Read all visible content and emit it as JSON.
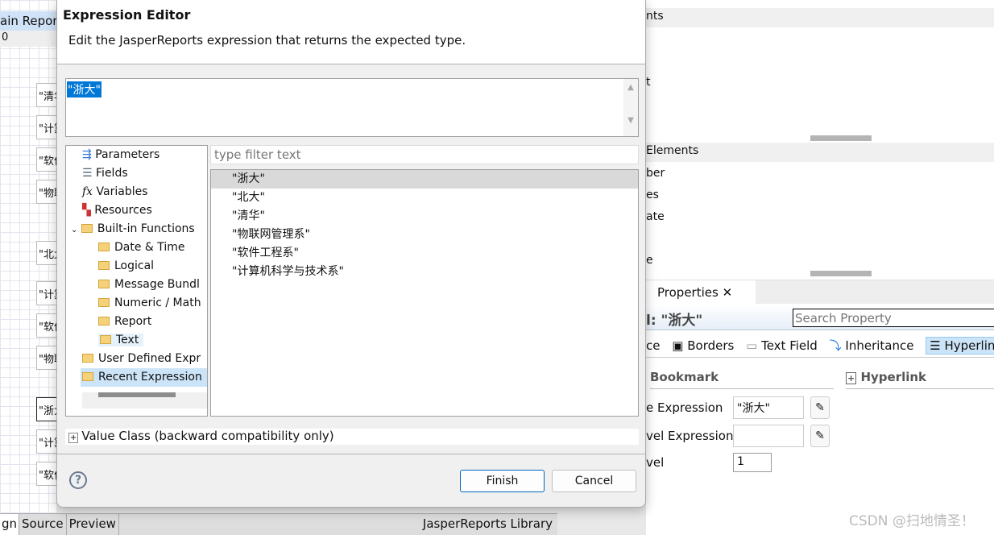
{
  "background_editor": {
    "tab_label": "ain Repor",
    "ruler": "0",
    "cells": [
      "\"清华",
      "\"计算",
      "\"软件",
      "\"物联",
      "\"北大",
      "\"计算",
      "\"软件",
      "\"物联",
      "\"浙大",
      "\"计算",
      "\"软件"
    ],
    "bottom_tabs": [
      "gn",
      "Source",
      "Preview"
    ],
    "library_label": "JasperReports Library"
  },
  "right_panel": {
    "section1_title": "nts",
    "section1_items": [
      "t"
    ],
    "section2_title": "Elements",
    "section2_items": [
      "ber",
      "es",
      "ate",
      "e"
    ],
    "properties_tab": "Properties",
    "element_title": "l: \"浙大\"",
    "search_placeholder": "Search Property",
    "tabs": [
      "ce",
      "Borders",
      "Text Field",
      "Inheritance",
      "Hyperlink"
    ],
    "bookmark_header": "Bookmark",
    "hyperlink_header": "Hyperlink",
    "rows": [
      {
        "label": "e Expression",
        "value": "\"浙大\""
      },
      {
        "label": "vel Expression",
        "value": ""
      },
      {
        "label": "vel",
        "value": "1"
      }
    ],
    "watermark": "CSDN @扫地情圣！"
  },
  "dialog": {
    "title": "Expression Editor",
    "description": "Edit the JasperReports expression that returns the expected type.",
    "expression": "\"浙大\"",
    "tree": {
      "parameters": "Parameters",
      "fields": "Fields",
      "variables": "Variables",
      "resources": "Resources",
      "builtin": "Built-in Functions",
      "builtin_children": [
        "Date & Time",
        "Logical",
        "Message Bundl",
        "Numeric / Math",
        "Report",
        "Text"
      ],
      "user_defined": "User Defined Expr",
      "recent": "Recent Expression"
    },
    "filter_placeholder": "type filter text",
    "list_items": [
      "\"浙大\"",
      "\"北大\"",
      "\"清华\"",
      "\"物联网管理系\"",
      "\"软件工程系\"",
      "\"计算机科学与技术系\""
    ],
    "value_class": "Value Class (backward compatibility only)",
    "finish": "Finish",
    "cancel": "Cancel",
    "help": "?"
  },
  "colors": {
    "selection": "#0078d7",
    "accent": "#1a73e8"
  }
}
